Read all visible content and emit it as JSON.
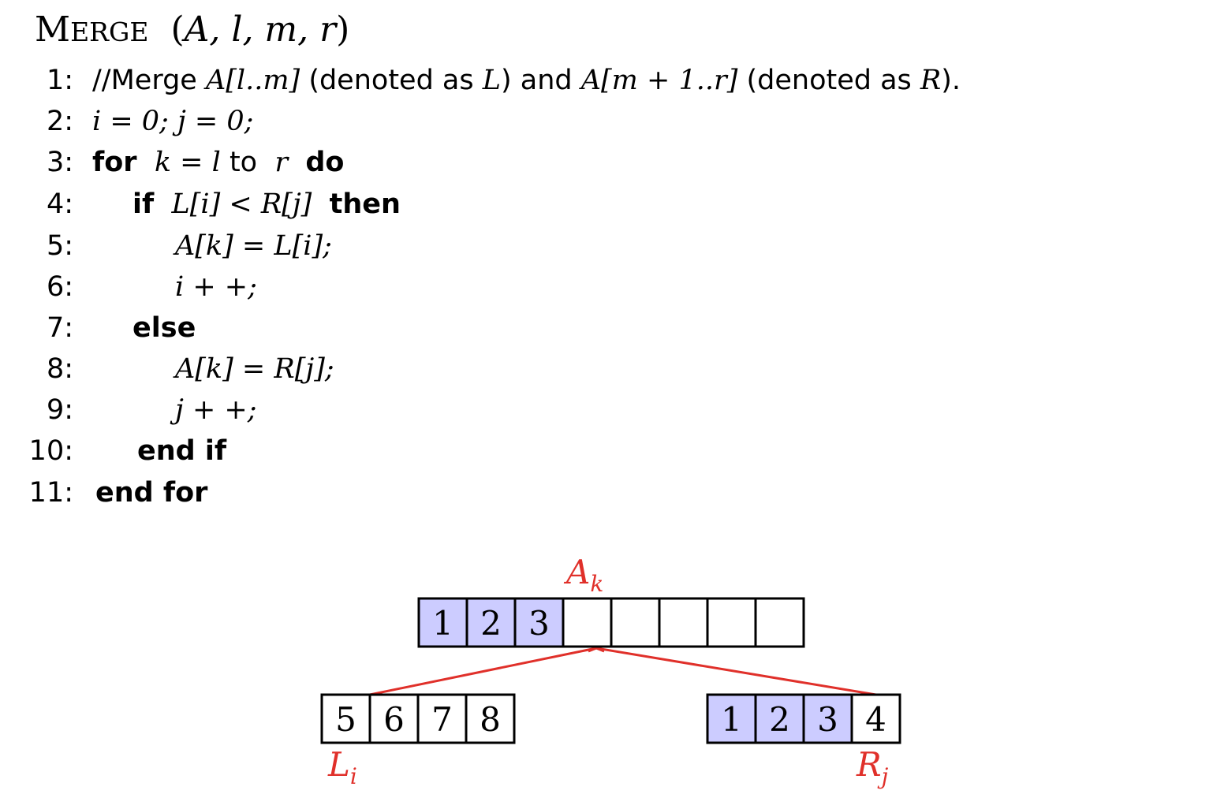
{
  "title": {
    "name_first": "M",
    "name_rest": "ERGE",
    "open": "(",
    "args": "A, l, m, r",
    "close": ")"
  },
  "lines": [
    {
      "num": "1:"
    },
    {
      "num": "2:"
    },
    {
      "num": "3:"
    },
    {
      "num": "4:"
    },
    {
      "num": "5:"
    },
    {
      "num": "6:"
    },
    {
      "num": "7:"
    },
    {
      "num": "8:"
    },
    {
      "num": "9:"
    },
    {
      "num": "10:"
    },
    {
      "num": "11:"
    }
  ],
  "code": {
    "l1": {
      "comment": "//Merge ",
      "range_l": "A[l..m]",
      "t1": " (denoted as ",
      "L": "L",
      "t2": ") and ",
      "range_r": "A[m + 1..r]",
      "t3": " (denoted as ",
      "R": "R",
      "t4": ")."
    },
    "l2": {
      "text": "i = 0; j = 0;"
    },
    "l3": {
      "kw_for": "for",
      "k": "k",
      "eq": " = ",
      "l": "l",
      "to": " to ",
      "r": "r",
      "kw_do": "do"
    },
    "l4": {
      "kw_if": "if",
      "cond": "L[i] < R[j]",
      "kw_then": "then"
    },
    "l5": {
      "text": "A[k] = L[i];"
    },
    "l6": {
      "text": "i + +;"
    },
    "l7": {
      "kw_else": "else"
    },
    "l8": {
      "text": "A[k] = R[j];"
    },
    "l9": {
      "text": "j + +;"
    },
    "l10": {
      "kw": "end if"
    },
    "l11": {
      "kw": "end for"
    }
  },
  "diagram": {
    "colors": {
      "filled": "#ccccff",
      "empty": "#ffffff",
      "border": "#000000",
      "pointer": "#e0302a"
    },
    "A": {
      "cells": [
        "1",
        "2",
        "3",
        "",
        "",
        "",
        "",
        ""
      ],
      "filled": [
        true,
        true,
        true,
        false,
        false,
        false,
        false,
        false
      ],
      "pointer_index": 3,
      "label_base": "A",
      "label_sub": "k"
    },
    "L": {
      "cells": [
        "5",
        "6",
        "7",
        "8"
      ],
      "filled": [
        false,
        false,
        false,
        false
      ],
      "pointer_index": 0,
      "label_base": "L",
      "label_sub": "i"
    },
    "R": {
      "cells": [
        "1",
        "2",
        "3",
        "4"
      ],
      "filled": [
        true,
        true,
        true,
        false
      ],
      "pointer_index": 3,
      "label_base": "R",
      "label_sub": "j"
    }
  }
}
